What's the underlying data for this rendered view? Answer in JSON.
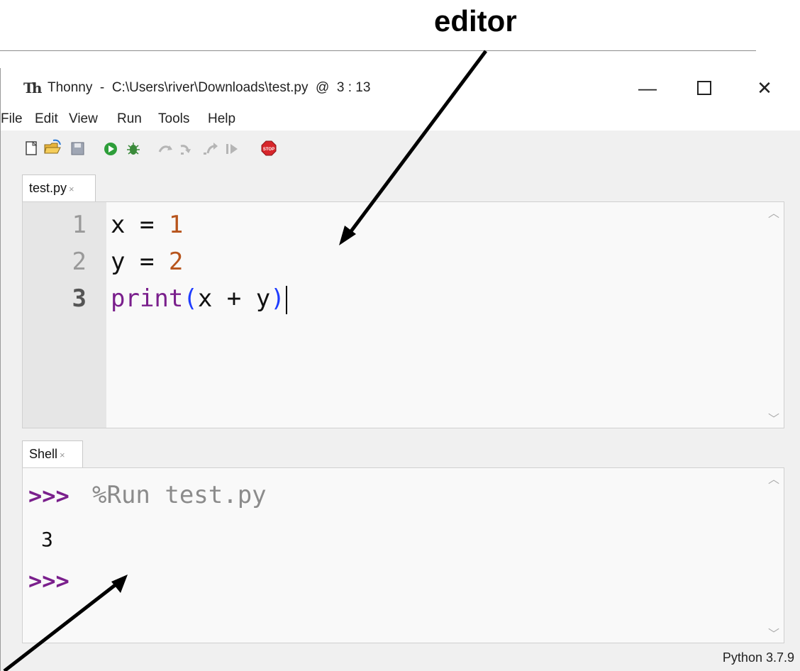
{
  "annotations": {
    "label": "editor"
  },
  "window": {
    "app_name": "Thonny",
    "title": "Thonny  -  C:\\Users\\river\\Downloads\\test.py  @  3 : 13",
    "controls": {
      "minimize": "—",
      "close": "✕"
    }
  },
  "menu": [
    "File",
    "Edit",
    "View",
    "Run",
    "Tools",
    "Help"
  ],
  "toolbar": {
    "icons": [
      "new-file-icon",
      "open-folder-icon",
      "save-icon",
      "run-icon",
      "debug-bug-icon",
      "step-over-icon",
      "step-into-icon",
      "step-out-icon",
      "resume-icon",
      "stop-icon"
    ],
    "stop_label": "STOP"
  },
  "editor": {
    "tab": {
      "label": "test.py",
      "close": "×"
    },
    "line_numbers": [
      "1",
      "2",
      "3"
    ],
    "current_line": 3,
    "lines": [
      {
        "var": "x",
        "op": " = ",
        "value": "1"
      },
      {
        "var": "y",
        "op": " = ",
        "value": "2"
      },
      {
        "func": "print",
        "open": "(",
        "args": "x + y",
        "close": ")"
      }
    ]
  },
  "shell": {
    "tab": {
      "label": "Shell",
      "close": "×"
    },
    "prompt": ">>>",
    "command": "%Run test.py",
    "output": "3"
  },
  "status": {
    "interpreter": "Python 3.7.9"
  },
  "colors": {
    "number": "#b7541c",
    "keyword": "#7a1f8c",
    "paren": "#1e3cff",
    "prompt": "#7a1f8c"
  }
}
